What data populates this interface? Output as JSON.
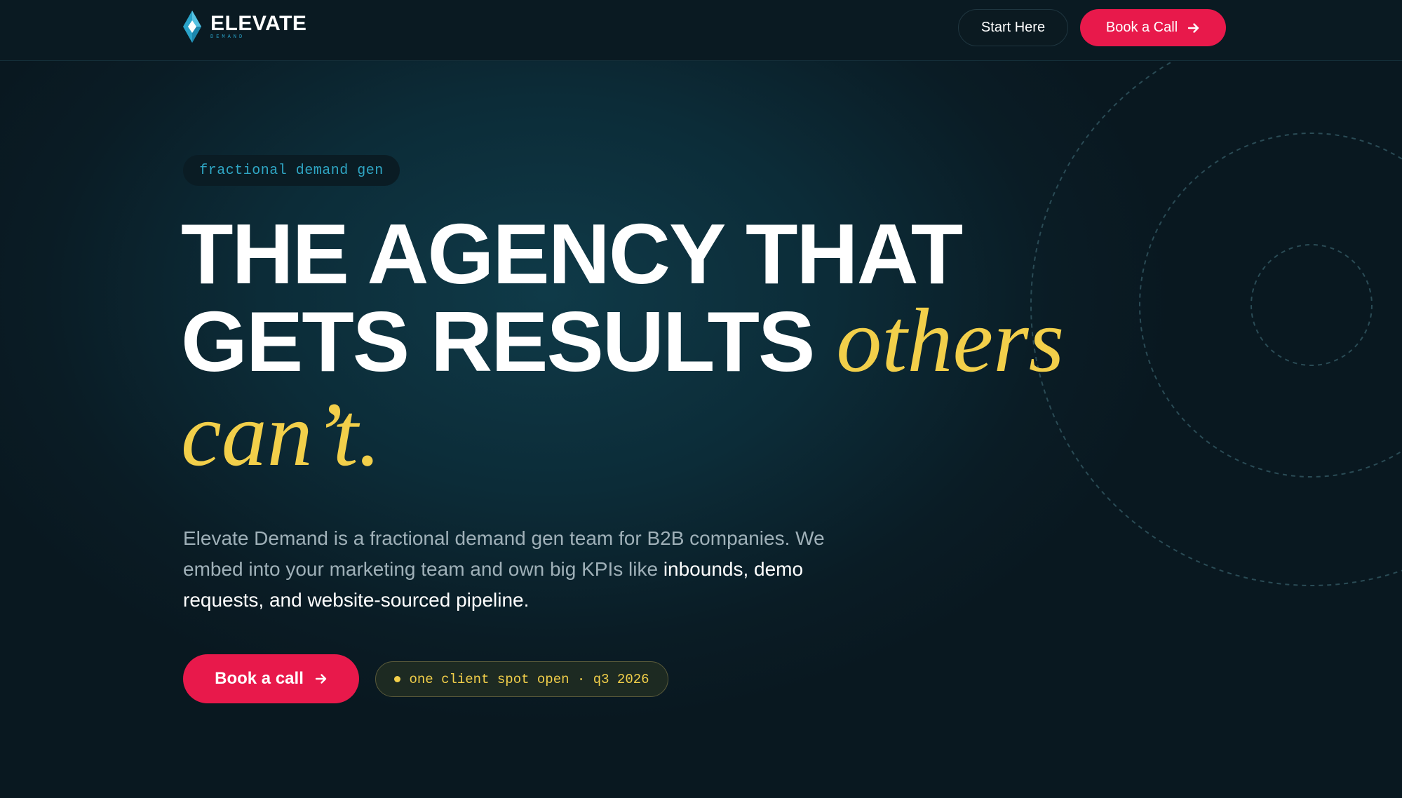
{
  "brand": {
    "name": "ELEVATE",
    "sub": "DEMAND",
    "logo_icon": "diamond-gem-icon",
    "colors": {
      "accent": "#e8194b",
      "teal": "#2aa3c9",
      "gold": "#f2cf4a",
      "background": "#0b1a22"
    }
  },
  "nav": {
    "start_label": "Start Here",
    "book_label": "Book a Call",
    "book_icon": "arrow-right-icon"
  },
  "hero": {
    "tag": "fractional demand gen",
    "headline_line1": "THE AGENCY THAT",
    "headline_line2_bold": "GETS RESULTS",
    "headline_line2_italic": "others",
    "headline_line3_italic": "can’t.",
    "description_plain": "Elevate Demand is a fractional demand gen team for B2B companies. We embed into your marketing team and own big KPIs like",
    "description_highlight": "inbounds, demo requests, and website-sourced pipeline.",
    "cta_label": "Book a call",
    "cta_icon": "arrow-right-icon",
    "availability": "one client spot open · q3 2026"
  }
}
